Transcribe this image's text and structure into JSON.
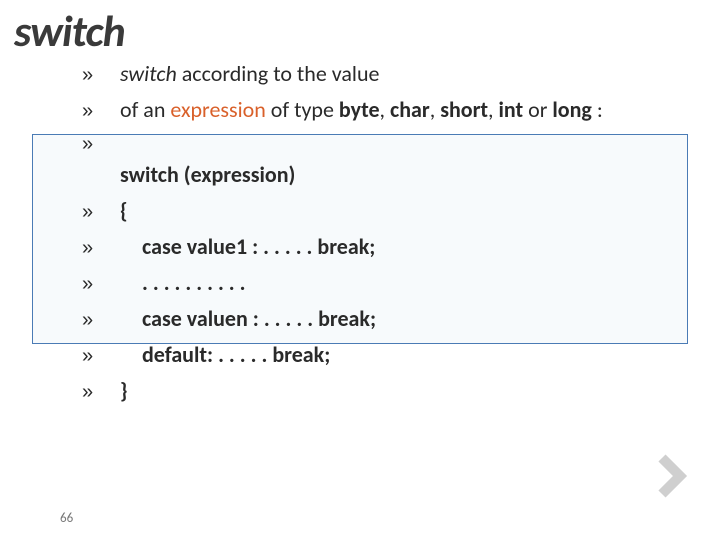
{
  "title": "switch",
  "lines": {
    "l1_switch": "switch",
    "l1_rest": " according to the value",
    "l2_a": "of an ",
    "l2_expr": "expression",
    "l2_b": " of type ",
    "l2_byte": "byte",
    "l2_c": ", ",
    "l2_char": "char",
    "l2_d": ", ",
    "l2_short": "short",
    "l2_e": ", ",
    "l2_int": "int",
    "l2_f": " or ",
    "l2_long": "long",
    "l2_g": " :",
    "l3": "switch (expression)",
    "l4": "{",
    "l5": "case value1 :  . . . . .  break;",
    "l6": ". . . . . . . . . .",
    "l7": "case valuen :  . . . . .  break;",
    "l8": "default:          . . . . .  break;",
    "l9": "}"
  },
  "pageNumber": "66",
  "icons": {
    "bullet": "»",
    "chevron": "chevron-right-icon"
  }
}
